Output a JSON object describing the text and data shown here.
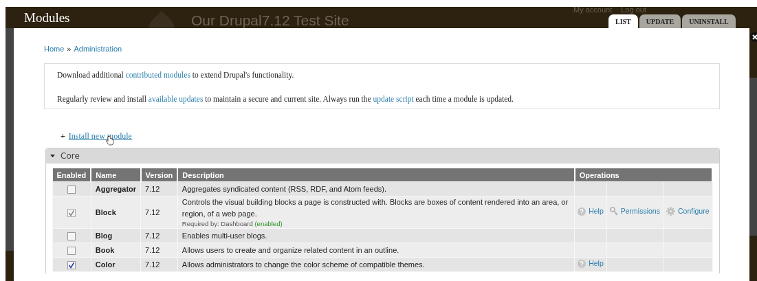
{
  "header": {
    "title": "Modules",
    "site_name": "Our Drupal7.12 Test Site",
    "user_links": [
      "My account",
      "Log out"
    ],
    "tabs": [
      {
        "label": "LIST",
        "selected": true
      },
      {
        "label": "UPDATE",
        "selected": false
      },
      {
        "label": "UNINSTALL",
        "selected": false
      }
    ]
  },
  "breadcrumb": [
    "Home",
    "Administration"
  ],
  "breadcrumb_separator": "»",
  "help": [
    [
      {
        "kind": "text",
        "text": "Download additional "
      },
      {
        "kind": "link",
        "text": "contributed modules"
      },
      {
        "kind": "text",
        "text": " to extend Drupal's functionality."
      }
    ],
    [
      {
        "kind": "text",
        "text": "Regularly review and install "
      },
      {
        "kind": "link",
        "text": "available updates"
      },
      {
        "kind": "text",
        "text": " to maintain a secure and current site. Always run the "
      },
      {
        "kind": "link",
        "text": "update script"
      },
      {
        "kind": "text",
        "text": " each time a module is updated."
      }
    ]
  ],
  "action_link": {
    "icon": "+",
    "label": "Install new module"
  },
  "fieldset": {
    "title": "Core",
    "expanded": true
  },
  "table": {
    "columns": [
      "Enabled",
      "Name",
      "Version",
      "Description",
      "Operations"
    ],
    "rows": [
      {
        "checked": false,
        "disabled": false,
        "name": "Aggregator",
        "version": "7.12",
        "description": "Aggregates syndicated content (RSS, RDF, and Atom feeds).",
        "operations": []
      },
      {
        "checked": true,
        "disabled": true,
        "name": "Block",
        "version": "7.12",
        "description": "Controls the visual building blocks a page is constructed with. Blocks are boxes of content rendered into an area, or region, of a web page.",
        "required_by": "Required by: Dashboard",
        "required_status": "(enabled)",
        "operations": [
          {
            "kind": "help",
            "label": "Help"
          },
          {
            "kind": "permissions",
            "label": "Permissions"
          },
          {
            "kind": "configure",
            "label": "Configure"
          }
        ]
      },
      {
        "checked": false,
        "disabled": false,
        "name": "Blog",
        "version": "7.12",
        "description": "Enables multi-user blogs.",
        "operations": []
      },
      {
        "checked": false,
        "disabled": false,
        "name": "Book",
        "version": "7.12",
        "description": "Allows users to create and organize related content in an outline.",
        "operations": []
      },
      {
        "checked": true,
        "disabled": false,
        "name": "Color",
        "version": "7.12",
        "description": "Allows administrators to change the color scheme of compatible themes.",
        "operations": [
          {
            "kind": "help",
            "label": "Help"
          }
        ]
      }
    ]
  }
}
